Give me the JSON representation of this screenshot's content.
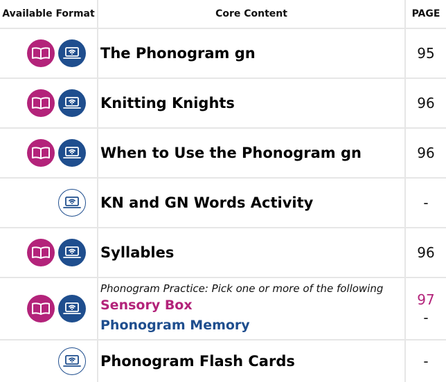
{
  "headers": {
    "format": "Available Format",
    "content": "Core Content",
    "page": "PAGE"
  },
  "colors": {
    "book": "#b3237a",
    "laptop": "#1f4e8e",
    "highlight_pink": "#b3237a",
    "highlight_blue": "#1f4e8e"
  },
  "icons": {
    "book": "book-icon",
    "laptop": "laptop-wifi-icon"
  },
  "rows": [
    {
      "title": "The Phonogram gn",
      "page": "95",
      "formats": [
        "book",
        "laptop"
      ]
    },
    {
      "title": "Knitting Knights",
      "page": "96",
      "formats": [
        "book",
        "laptop"
      ]
    },
    {
      "title": "When to Use the Phonogram gn",
      "page": "96",
      "formats": [
        "book",
        "laptop"
      ]
    },
    {
      "title": "KN and GN Words Activity",
      "page": "-",
      "formats": [
        "laptop"
      ]
    },
    {
      "title": "Syllables",
      "page": "96",
      "formats": [
        "book",
        "laptop"
      ]
    },
    {
      "intro": "Phonogram Practice: Pick one or more of the following",
      "options": [
        {
          "label": "Sensory Box",
          "page": "97"
        },
        {
          "label": "Phonogram Memory",
          "page": "-"
        }
      ],
      "formats": [
        "book",
        "laptop"
      ]
    },
    {
      "title": "Phonogram Flash Cards",
      "page": "-",
      "formats": [
        "laptop"
      ]
    }
  ]
}
